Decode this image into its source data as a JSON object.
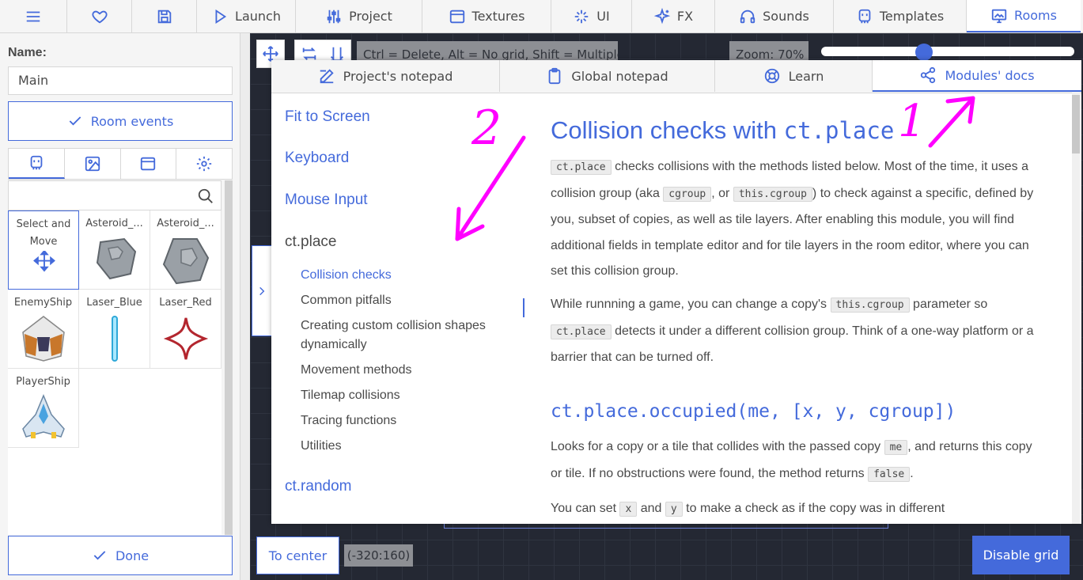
{
  "topbar": {
    "tabs": [
      {
        "label": "Launch",
        "icon": "play-icon"
      },
      {
        "label": "Project",
        "icon": "sliders-icon"
      },
      {
        "label": "Textures",
        "icon": "texture-icon"
      },
      {
        "label": "UI",
        "icon": "ui-icon"
      },
      {
        "label": "FX",
        "icon": "sparkles-icon"
      },
      {
        "label": "Sounds",
        "icon": "headphones-icon"
      },
      {
        "label": "Templates",
        "icon": "template-icon"
      },
      {
        "label": "Rooms",
        "icon": "room-icon"
      }
    ],
    "active_tab": "Rooms",
    "accent_color": "#446adb"
  },
  "left_panel": {
    "name_label": "Name:",
    "name_value": "Main",
    "room_events_label": "Room events",
    "done_label": "Done",
    "asset_tab_icons": [
      "copy-icon",
      "background-icon",
      "tile-icon",
      "gear-icon"
    ],
    "assets": [
      {
        "label": "Select and Move"
      },
      {
        "label": "Asteroid_..."
      },
      {
        "label": "Asteroid_..."
      },
      {
        "label": "EnemyShip"
      },
      {
        "label": "Laser_Blue"
      },
      {
        "label": "Laser_Red"
      },
      {
        "label": "PlayerShip"
      }
    ]
  },
  "canvas": {
    "hint": "Ctrl = Delete, Alt = No grid, Shift = Multiple",
    "zoom": "Zoom: 70%",
    "to_center_label": "To center",
    "coords": "(-320:160)",
    "disable_grid_label": "Disable grid"
  },
  "docs": {
    "tabs": [
      {
        "label": "Project's notepad",
        "icon": "edit-icon"
      },
      {
        "label": "Global notepad",
        "icon": "clipboard-icon"
      },
      {
        "label": "Learn",
        "icon": "lifebuoy-icon"
      },
      {
        "label": "Modules' docs",
        "icon": "share-icon"
      }
    ],
    "active_tab": "Modules' docs",
    "nav": {
      "fit_to_screen": "Fit to Screen",
      "keyboard": "Keyboard",
      "mouse_input": "Mouse Input",
      "ct_place": "ct.place",
      "sub": [
        "Collision checks",
        "Common pitfalls",
        "Creating custom collision shapes dynamically",
        "Movement methods",
        "Tilemap collisions",
        "Tracing functions",
        "Utilities"
      ],
      "active_sub": "Collision checks",
      "ct_random": "ct.random"
    },
    "content": {
      "title_text": "Collision checks with ",
      "title_code": "ct.place",
      "p1": {
        "c1": "ct.place",
        "t1": " checks collisions with the methods listed below. Most of the time, it uses a collision group (aka ",
        "c2": "cgroup",
        "t2": ", or ",
        "c3": "this.cgroup",
        "t3": ") to check against a specific, defined by you, subset of copies, as well as tile layers. After enabling this module, you will find additional fields in template editor and for tile layers in the room editor, where you can set this collision group."
      },
      "p2": {
        "t1": "While runnning a game, you can change a copy's ",
        "c1": "this.cgroup",
        "t2": " parameter so ",
        "c2": "ct.place",
        "t3": " detects it under a different collision group. Think of a one-way platform or a barrier that can be turned off."
      },
      "subheading": "ct.place.occupied(me, [x, y, cgroup])",
      "p3": {
        "t1": "Looks for a copy or a tile that collides with the passed copy ",
        "c1": "me",
        "t2": ", and returns this copy or tile. If no obstructions were found, the method returns ",
        "c2": "false",
        "t3": "."
      },
      "p4": {
        "t1": "You can set ",
        "c1": "x",
        "t2": " and ",
        "c2": "y",
        "t3": " to make a check as if the copy was in different"
      }
    }
  },
  "annotations": {
    "mark1": "1",
    "mark2": "2",
    "color": "#ff00ff"
  }
}
